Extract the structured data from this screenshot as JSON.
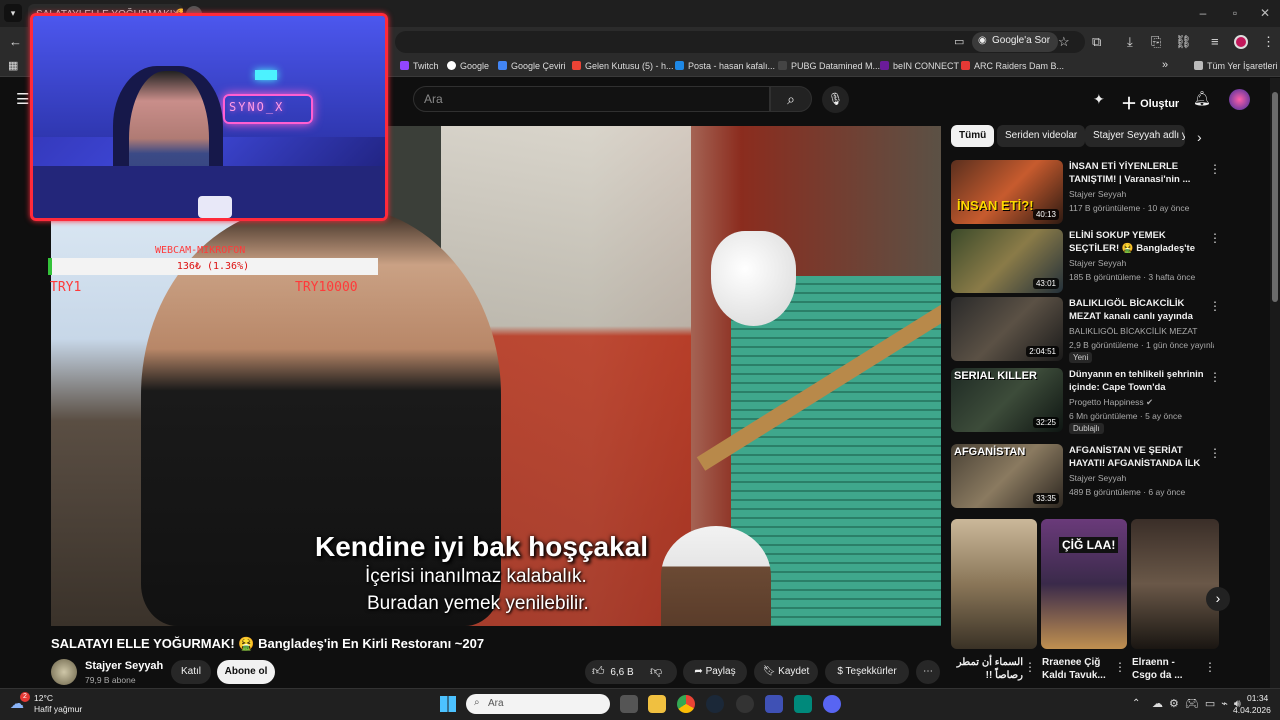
{
  "browser": {
    "tab_title": "SALATAYI ELLE YOĞURMAK! 🤮",
    "omnibox_action": "Google'a Sor",
    "bookmarks": [
      "Twitch",
      "Google",
      "Google Çeviri",
      "Gelen Kutusu (5) - h...",
      "Posta - hasan kafalı...",
      "PUBG Datamined M...",
      "beIN CONNECT",
      "ARC Raiders Dam B..."
    ],
    "bookmarks_more": "»",
    "all_bookmarks": "Tüm Yer İşaretleri"
  },
  "youtube": {
    "search_placeholder": "Ara",
    "create_label": "Oluştur",
    "video": {
      "overlay_label": "SYNO_X",
      "mic_bar_title": "WEBCAM-MIKROFON",
      "mic_bar_value": "136₺ (1.36%)",
      "mic_bar_progress": 0.0136,
      "mic_left_label": "TRY1",
      "mic_right_label": "TRY10000",
      "caption_main": "Kendine iyi bak hoşçakal",
      "subtitle_line1": "İçerisi inanılmaz kalabalık.",
      "subtitle_line2": "Buradan yemek yenilebilir."
    },
    "title": "SALATAYI ELLE YOĞURMAK! 🤮 Bangladeş'in En Kirli Restoranı ~207",
    "channel": {
      "name": "Stajyer Seyyah",
      "subs": "79,9 B abone",
      "join": "Katıl",
      "subscribe": "Abone ol"
    },
    "actions": {
      "likes": "6,6 B",
      "share": "Paylaş",
      "save": "Kaydet",
      "thanks": "Teşekkürler",
      "more": "⋯"
    },
    "chips": [
      "Tümü",
      "Seriden videolar",
      "Stajyer Seyyah adlı yü"
    ],
    "recommendations": [
      {
        "title": "İNSAN ETİ YİYENLERLE TANIŞTIM! | Varanasi'nin ...",
        "channel": "Stajyer Seyyah",
        "meta": "117 B görüntüleme · 10 ay önce",
        "duration": "40:13",
        "thumb_text": "İNSAN ETİ?!",
        "badge": ""
      },
      {
        "title": "ELİNİ SOKUP YEMEK SEÇTİLER! 🤮 Bangladeş'te İftar Kaosu ...",
        "channel": "Stajyer Seyyah",
        "meta": "185 B görüntüleme · 3 hafta önce",
        "duration": "43:01",
        "thumb_text": "",
        "badge": ""
      },
      {
        "title": "BALIKLIGÖL BİCAKCİLİK MEZAT kanalı canlı yayında",
        "channel": "BALIKLIGÖL BİCAKCİLİK MEZAT",
        "meta": "2,9 B görüntüleme · 1 gün önce yayınlandı",
        "duration": "2:04:51",
        "thumb_text": "",
        "badge": "Yeni"
      },
      {
        "title": "Dünyanın en tehlikeli şehrinin içinde: Cape Town'da yaşamak...",
        "channel": "Progetto Happiness ✔",
        "meta": "6 Mn görüntüleme · 5 ay önce",
        "duration": "32:25",
        "thumb_text": "SERIAL KILLER",
        "badge": "Dublajlı"
      },
      {
        "title": "AFGANİSTAN VE ŞERİAT HAYATI! AFGANİSTANDA İLK ...",
        "channel": "Stajyer Seyyah",
        "meta": "489 B görüntüleme · 6 ay önce",
        "duration": "33:35",
        "thumb_text": "AFGANİSTAN",
        "badge": ""
      }
    ],
    "shorts": [
      {
        "title": "السماء أن تمطر رصاصاً !!",
        "thumb_text": ""
      },
      {
        "title": "Rraenee Çiğ Kaldı Tavuk...",
        "thumb_text": "ÇİĞ LAA!"
      },
      {
        "title": "Elraenn - Csgo da ...",
        "thumb_text": ""
      }
    ]
  },
  "taskbar": {
    "weather_temp": "12°C",
    "weather_desc": "Hafif yağmur",
    "weather_badge": "2",
    "search_placeholder": "Ara",
    "time": "01:34",
    "date": "4.04.2026"
  },
  "colors": {
    "accent_red": "#ff2a3a",
    "bar_green": "#34c23a",
    "yt_bg": "#0f0f0f"
  }
}
